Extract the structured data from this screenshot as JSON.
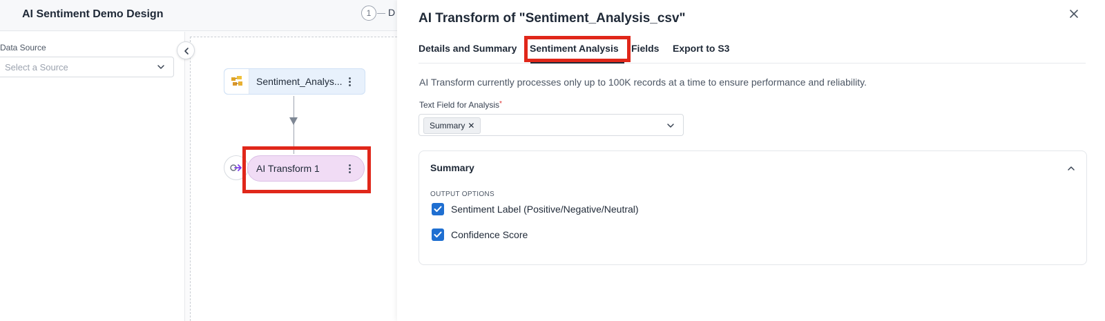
{
  "app": {
    "title": "AI Sentiment Demo Design",
    "step_number": "1",
    "step_label": "D",
    "data_source": {
      "label": "Data Source",
      "placeholder": "Select a Source"
    },
    "nodes": [
      {
        "label": "Sentiment_Analys...",
        "icon": "data-source-icon"
      },
      {
        "label": "AI Transform 1",
        "icon": "transform-arrow-icon"
      }
    ]
  },
  "drawer": {
    "title": "AI Transform of \"Sentiment_Analysis_csv\"",
    "tabs": [
      {
        "label": "Details and Summary",
        "active": false
      },
      {
        "label": "Sentiment Analysis",
        "active": true
      },
      {
        "label": "Fields",
        "active": false
      },
      {
        "label": "Export to S3",
        "active": false
      }
    ],
    "notice": "AI Transform currently processes only up to 100K records at a time to ensure performance and reliability.",
    "text_field": {
      "label": "Text Field for Analysis",
      "required_mark": "*",
      "selected": [
        "Summary"
      ]
    },
    "summary_card": {
      "title": "Summary",
      "section_label": "OUTPUT OPTIONS",
      "options": [
        {
          "label": "Sentiment Label (Positive/Negative/Neutral)",
          "checked": true
        },
        {
          "label": "Confidence Score",
          "checked": true
        }
      ]
    }
  },
  "colors": {
    "highlight": "#e0271a",
    "checkbox": "#1f6fd1",
    "node_source_bg": "#e8f1fc",
    "node_transform_bg": "#f1dcf5"
  }
}
